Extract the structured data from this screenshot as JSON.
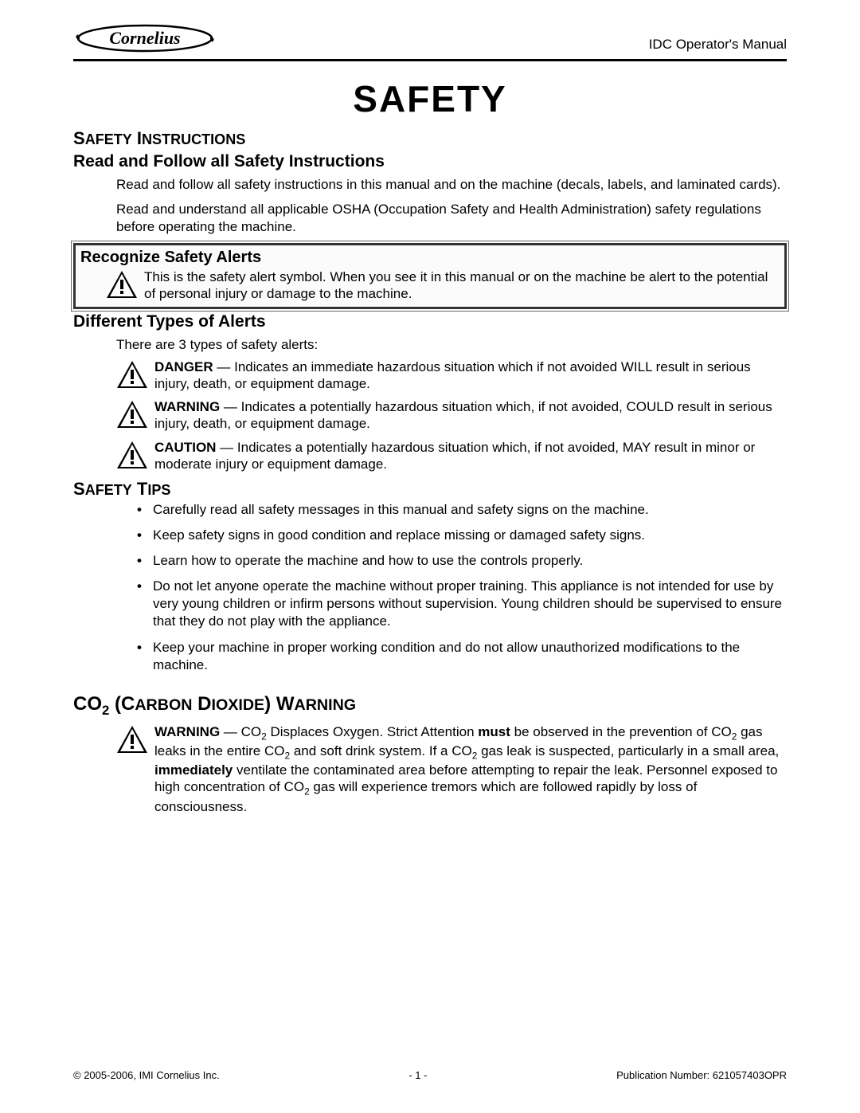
{
  "header": {
    "brand": "Cornelius",
    "doc_title": "IDC Operator's Manual"
  },
  "main_title": "SAFETY",
  "safety_instructions": {
    "heading": "Safety Instructions",
    "sub1": "Read and Follow all Safety Instructions",
    "p1": "Read and follow all safety instructions in this manual and on the machine (decals, labels, and laminated cards).",
    "p2": "Read and understand all applicable OSHA (Occupation Safety and Health Administration) safety regulations before operating the machine.",
    "recognize_heading": "Recognize Safety Alerts",
    "recognize_text": "This is the safety alert symbol. When you see it in this manual or on the machine be alert to the potential of personal injury or damage to the machine.",
    "types_heading": "Different Types of Alerts",
    "types_intro": "There are 3 types of safety alerts:",
    "alerts": [
      {
        "label": "DANGER",
        "text": " — Indicates an immediate hazardous situation which if not avoided WILL result in serious injury, death, or equipment damage."
      },
      {
        "label": "WARNING",
        "text": " — Indicates a potentially hazardous situation which, if not avoided, COULD result in serious injury, death, or equipment damage."
      },
      {
        "label": "CAUTION",
        "text": " — Indicates a potentially hazardous situation which, if not avoided, MAY result in minor or moderate injury or equipment damage."
      }
    ]
  },
  "safety_tips": {
    "heading": "Safety Tips",
    "items": [
      "Carefully read all safety messages in this manual and safety signs on the machine.",
      "Keep safety signs in good condition and replace missing or damaged safety signs.",
      "Learn how to operate the machine and how to use the controls properly.",
      "Do not let anyone operate the machine without proper training. This appliance is not intended for use by very young children or infirm persons without supervision. Young children should be supervised to ensure that they do not play with the appliance.",
      "Keep your machine in proper working condition and do not allow unauthorized modifications to the machine."
    ]
  },
  "co2_warning": {
    "heading_html": "CO₂ (Carbon Dioxide) Warning",
    "label": "WARNING",
    "text_1": " — CO",
    "text_2": " Displaces Oxygen. Strict Attention ",
    "must": "must",
    "text_3": " be observed in the prevention of CO",
    "text_4": " gas leaks in the entire CO",
    "text_5": " and soft drink system. If a CO",
    "text_6": " gas leak is suspected, particularly in a small area, ",
    "immediately": "immediately",
    "text_7": " ventilate the contaminated area before attempting to repair the leak. Personnel exposed to high concentration of CO",
    "text_8": " gas will experience tremors which are followed rapidly by loss of consciousness."
  },
  "footer": {
    "left": "© 2005-2006, IMI Cornelius Inc.",
    "center": "- 1 -",
    "right": "Publication Number: 621057403OPR"
  }
}
